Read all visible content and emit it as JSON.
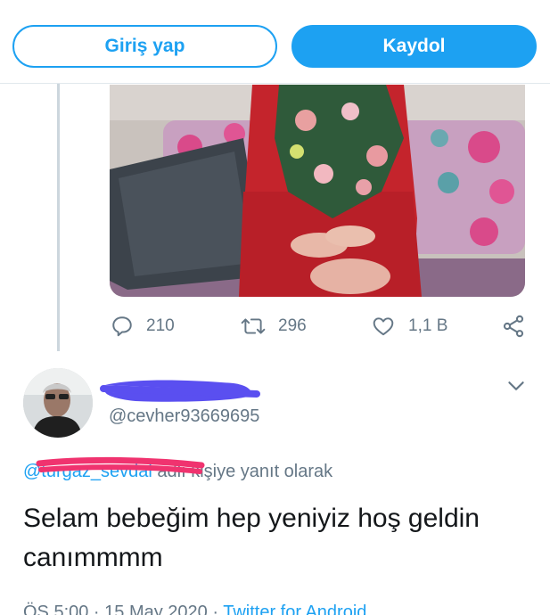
{
  "header": {
    "login_label": "Giriş yap",
    "signup_label": "Kaydol"
  },
  "stats": {
    "replies": "210",
    "retweets": "296",
    "likes": "1,1 B"
  },
  "reply": {
    "handle": "@cevher93669695",
    "reply_to_mention": "@turgaz_sevdal",
    "reply_to_suffix": "adlı kişiye yanıt olarak",
    "text": "Selam bebeğim hep yeniyiz hoş geldin canımmmm",
    "timestamp": "ÖS 5:00 · 15 May 2020 · ",
    "source": "Twitter for Android"
  },
  "colors": {
    "accent": "#1da1f2",
    "secondary_text": "#657786",
    "redaction_blue": "#5a4ff0",
    "redaction_pink": "#f0336f"
  },
  "icons": [
    "reply-icon",
    "retweet-icon",
    "like-icon",
    "share-icon",
    "chevron-down-icon"
  ]
}
